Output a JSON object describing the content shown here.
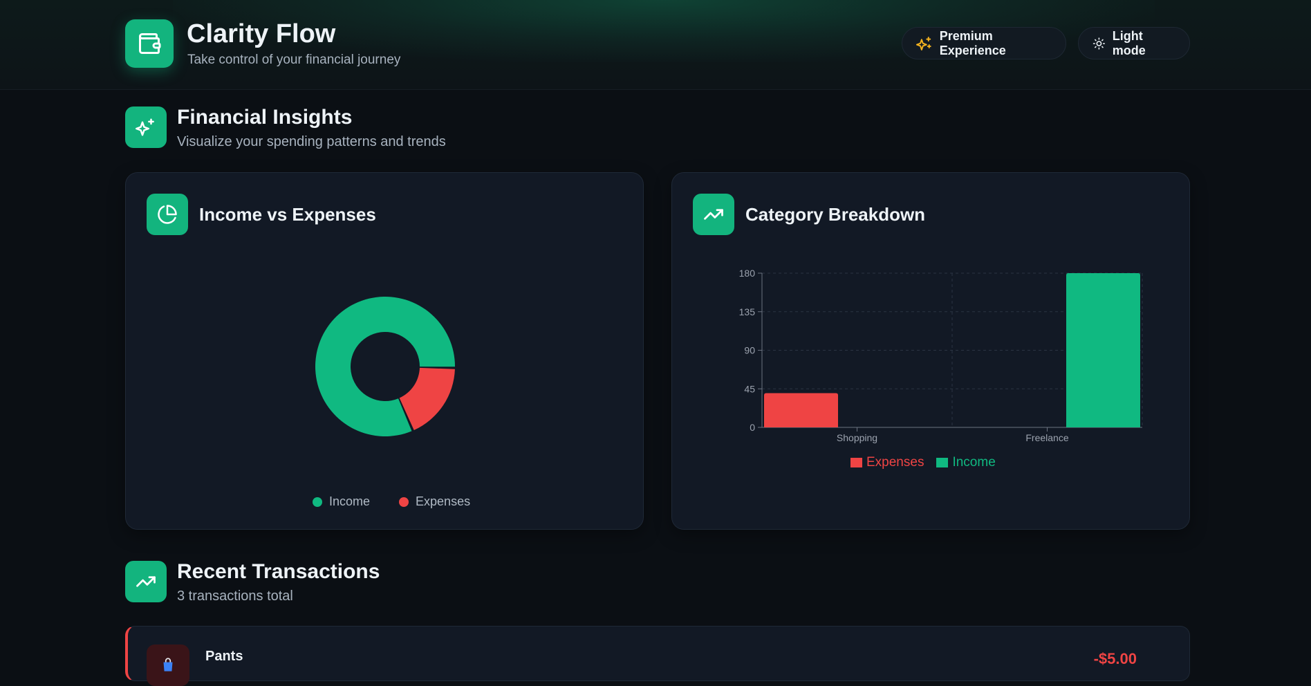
{
  "header": {
    "title": "Clarity Flow",
    "subtitle": "Take control of your financial journey",
    "premium_label": "Premium Experience",
    "theme_label": "Light mode",
    "logo_icon": "wallet-icon",
    "premium_icon": "sparkles-icon",
    "theme_icon": "sun-icon"
  },
  "insights": {
    "title": "Financial Insights",
    "subtitle": "Visualize your spending patterns and trends",
    "icon": "sparkles-icon"
  },
  "income_card": {
    "title": "Income vs Expenses",
    "icon": "pie-chart-icon"
  },
  "category_card": {
    "title": "Category Breakdown",
    "icon": "trending-up-icon"
  },
  "transactions": {
    "title": "Recent Transactions",
    "subtitle": "3 transactions total",
    "icon": "trending-up-icon",
    "items": [
      {
        "name": "Pants",
        "amount": "-$5.00",
        "icon": "shopping-bag-icon",
        "type": "expense"
      }
    ]
  },
  "colors": {
    "accent": "#10b981",
    "expense": "#ef4444",
    "background": "#0b0f14",
    "card": "#121925"
  },
  "chart_data": [
    {
      "type": "pie",
      "donut": true,
      "labels": [
        "Income",
        "Expenses"
      ],
      "values": [
        180,
        40
      ],
      "colors": [
        "#10b981",
        "#ef4444"
      ],
      "legend_position": "bottom"
    },
    {
      "type": "bar",
      "categories": [
        "Shopping",
        "Freelance"
      ],
      "series": [
        {
          "name": "Expenses",
          "values": [
            40,
            0
          ],
          "color": "#ef4444"
        },
        {
          "name": "Income",
          "values": [
            0,
            180
          ],
          "color": "#10b981"
        }
      ],
      "yticks": [
        "0",
        "45",
        "90",
        "135",
        "180"
      ],
      "ylim": [
        0,
        180
      ],
      "grid": true,
      "legend_position": "bottom"
    }
  ]
}
